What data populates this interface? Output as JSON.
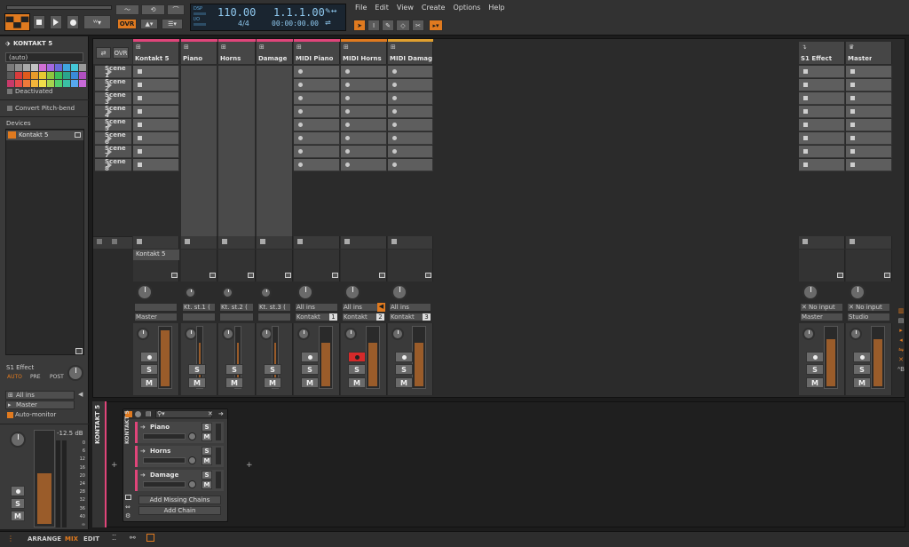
{
  "transport": {
    "dsp_label": "DSP",
    "io_label": "I/O",
    "tempo": "110.00",
    "time_signature": "4/4",
    "position": "1.1.1.00",
    "time": "00:00:00.00",
    "ovr_label": "OVR"
  },
  "menu": [
    "File",
    "Edit",
    "View",
    "Create",
    "Options",
    "Help"
  ],
  "inspector": {
    "title": "KONTAKT 5",
    "channel_value": "(auto)",
    "deactivated_label": "Deactivated",
    "convert_label": "Convert Pitch-bend",
    "devices_label": "Devices",
    "device_name": "Kontakt 5",
    "send_label": "S1 Effect",
    "send_modes": [
      "AUTO",
      "PRE",
      "POST"
    ],
    "input": "All ins",
    "output": "Master",
    "automonitor_label": "Auto-monitor",
    "db": "-12.5 dB",
    "scale": [
      "0",
      "6",
      "12",
      "16",
      "20",
      "24",
      "28",
      "32",
      "36",
      "40",
      "∞"
    ],
    "swatches": [
      "#7a7a7a",
      "#8f8f8f",
      "#a8a8a8",
      "#c2c2c2",
      "#d06fd4",
      "#a468e0",
      "#6a6ad8",
      "#3fa6e0",
      "#44c8d8",
      "#9a9a9a",
      "#5a5a5a",
      "#d93c3c",
      "#e05a1c",
      "#e89a2a",
      "#e6c832",
      "#8ec63f",
      "#3cbf5a",
      "#2aa58c",
      "#3a8bd8",
      "#b04fc0",
      "#c83a6a",
      "#e64c4c",
      "#f07a3a",
      "#f2b43a",
      "#f0dc4a",
      "#a6d44e",
      "#52cf6e",
      "#3abfa4",
      "#56a8ee",
      "#c86ad8"
    ]
  },
  "header_buttons": {
    "ovr": "OVR"
  },
  "scenes": [
    "Scene 1",
    "Scene 2",
    "Scene 3",
    "Scene 4",
    "Scene 5",
    "Scene 6",
    "Scene 7",
    "Scene 8"
  ],
  "tracks": [
    {
      "name": "Kontakt 5",
      "color": "#e0457a",
      "input": "",
      "output": "Master"
    },
    {
      "name": "Piano",
      "color": "#e0457a",
      "input": "Kt. st.1 (",
      "output": ""
    },
    {
      "name": "Horns",
      "color": "#e0457a",
      "input": "Kt. st.2 (",
      "output": ""
    },
    {
      "name": "Damage",
      "color": "#e0457a",
      "input": "Kt. st.3 (",
      "output": ""
    },
    {
      "name": "MIDI Piano",
      "color": "#e0457a",
      "input": "All ins",
      "output": "Kontakt",
      "num": "1"
    },
    {
      "name": "MIDI Horns",
      "color": "#e07a1f",
      "input": "All ins",
      "output": "Kontakt",
      "num": "2"
    },
    {
      "name": "MIDI Damage",
      "color": "#e0a030",
      "input": "All ins",
      "output": "Kontakt",
      "num": "3"
    }
  ],
  "group_label": "Kontakt 5",
  "fx_tracks": [
    {
      "name": "S1 Effect",
      "input": "No input",
      "output": "Master"
    },
    {
      "name": "Master",
      "input": "No input",
      "output": "Studio"
    }
  ],
  "device_panel": {
    "title": "KONTAKT 5",
    "chains": [
      "Piano",
      "Horns",
      "Damage"
    ],
    "add_missing": "Add Missing Chains",
    "add_chain": "Add Chain"
  },
  "bottom_tabs": {
    "arrange": "ARRANGE",
    "mix": "MIX",
    "edit": "EDIT"
  },
  "sm": {
    "s": "S",
    "m": "M"
  }
}
